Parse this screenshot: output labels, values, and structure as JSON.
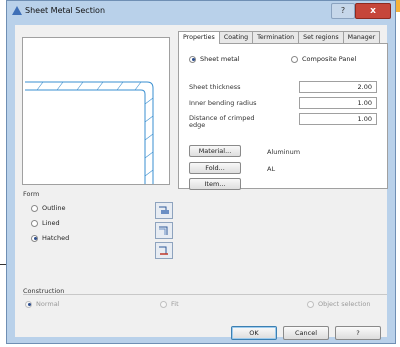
{
  "window": {
    "title": "Sheet Metal Section",
    "help_label": "?",
    "close_label": "x"
  },
  "form": {
    "label": "Form",
    "options": [
      {
        "label": "Outline",
        "selected": false
      },
      {
        "label": "Lined",
        "selected": false
      },
      {
        "label": "Hatched",
        "selected": true
      }
    ]
  },
  "tabs": [
    "Properties",
    "Coating",
    "Termination",
    "Set regions",
    "Manager"
  ],
  "active_tab": "Properties",
  "properties": {
    "type_options": [
      {
        "label": "Sheet metal",
        "selected": true
      },
      {
        "label": "Composite Panel",
        "selected": false
      }
    ],
    "sheet_thickness": {
      "label": "Sheet thickness",
      "value": "2.00"
    },
    "inner_bending_radius": {
      "label": "Inner bending radius",
      "value": "1.00"
    },
    "distance_crimped_edge": {
      "label_line1": "Distance of crimped",
      "label_line2": "edge",
      "value": "1.00"
    },
    "material": {
      "button": "Material...",
      "value": "Aluminum"
    },
    "fold": {
      "button": "Fold...",
      "value": "AL"
    },
    "item": {
      "button": "Item..."
    }
  },
  "construction": {
    "label": "Construction",
    "options": [
      {
        "label": "Normal",
        "selected": true,
        "enabled": false
      },
      {
        "label": "Fit",
        "selected": false,
        "enabled": false
      },
      {
        "label": "Object selection",
        "selected": false,
        "enabled": false
      }
    ]
  },
  "buttons": {
    "ok": "OK",
    "cancel": "Cancel",
    "help": "?"
  },
  "colors": {
    "accent_orange": "#f5b23a",
    "hatch_blue": "#3a8fd0",
    "window_frame": "#b9d1ea"
  }
}
